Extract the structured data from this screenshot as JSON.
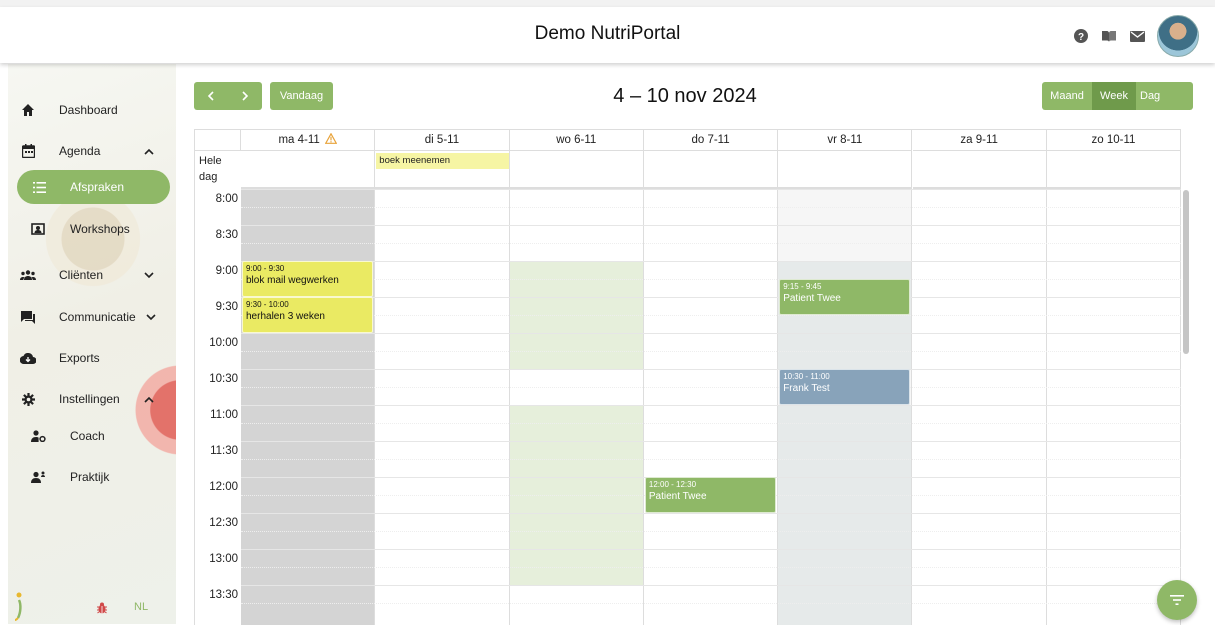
{
  "header": {
    "title": "Demo NutriPortal"
  },
  "sidebar": {
    "items": [
      {
        "label": "Dashboard",
        "icon": "home-icon"
      },
      {
        "label": "Agenda",
        "icon": "calendar-icon"
      },
      {
        "label": "Afspraken",
        "icon": "list-icon"
      },
      {
        "label": "Workshops",
        "icon": "presentation-icon"
      },
      {
        "label": "Cliënten",
        "icon": "people-icon"
      },
      {
        "label": "Communicatie",
        "icon": "chat-icon"
      },
      {
        "label": "Exports",
        "icon": "cloud-download-icon"
      },
      {
        "label": "Instellingen",
        "icon": "gear-icon"
      },
      {
        "label": "Coach",
        "icon": "user-gear-icon"
      },
      {
        "label": "Praktijk",
        "icon": "user-badge-icon"
      }
    ],
    "language": "NL"
  },
  "toolbar": {
    "prev": "‹",
    "next": "›",
    "today": "Vandaag",
    "title": "4 – 10 nov 2024",
    "views": [
      "Maand",
      "Week",
      "Dag"
    ],
    "selected_view": "Week"
  },
  "calendar": {
    "days": [
      "ma 4-11",
      "di 5-11",
      "wo 6-11",
      "do 7-11",
      "vr 8-11",
      "za 9-11",
      "zo 10-11"
    ],
    "allday_label": "Hele dag",
    "allday_events": [
      {
        "day": 1,
        "title": "boek meenemen"
      }
    ],
    "time_labels": [
      "8:00",
      "8:30",
      "9:00",
      "9:30",
      "10:00",
      "10:30",
      "11:00",
      "11:30",
      "12:00",
      "12:30",
      "13:00",
      "13:30"
    ],
    "events": [
      {
        "day": 0,
        "time": "9:00 - 9:30",
        "title": "blok mail wegwerken",
        "color": "#eaea63"
      },
      {
        "day": 0,
        "time": "9:30 - 10:00",
        "title": "herhalen 3 weken",
        "color": "#eaea63"
      },
      {
        "day": 4,
        "time": "9:15 - 9:45",
        "title": "Patient Twee",
        "color": "#8fb867"
      },
      {
        "day": 4,
        "time": "10:30 - 11:00",
        "title": "Frank Test",
        "color": "#88a3ba"
      },
      {
        "day": 3,
        "time": "12:00 - 12:30",
        "title": "Patient Twee",
        "color": "#8fb867"
      }
    ]
  },
  "colors": {
    "accent": "#8fb867",
    "accent_dark": "#6f9a4b",
    "warning": "#e8a33a"
  }
}
